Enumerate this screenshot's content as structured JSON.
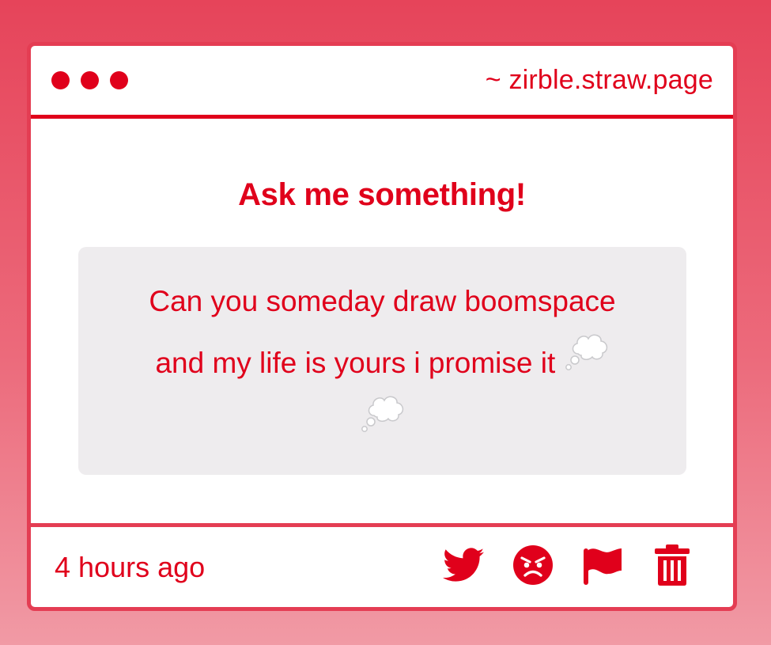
{
  "window": {
    "domain": "~ zirble.straw.page"
  },
  "content": {
    "heading": "Ask me something!",
    "question_line1": "Can you someday draw boomspace",
    "question_line2": "and my life is yours i promise it"
  },
  "footer": {
    "timestamp": "4 hours ago",
    "actions": [
      "twitter-icon",
      "angry-face-icon",
      "flag-icon",
      "trash-icon"
    ]
  },
  "colors": {
    "accent": "#e0001b",
    "border": "#e43d53",
    "question_bg": "#eeecee"
  },
  "icons": {
    "emoji": "thought-balloon-icon"
  }
}
